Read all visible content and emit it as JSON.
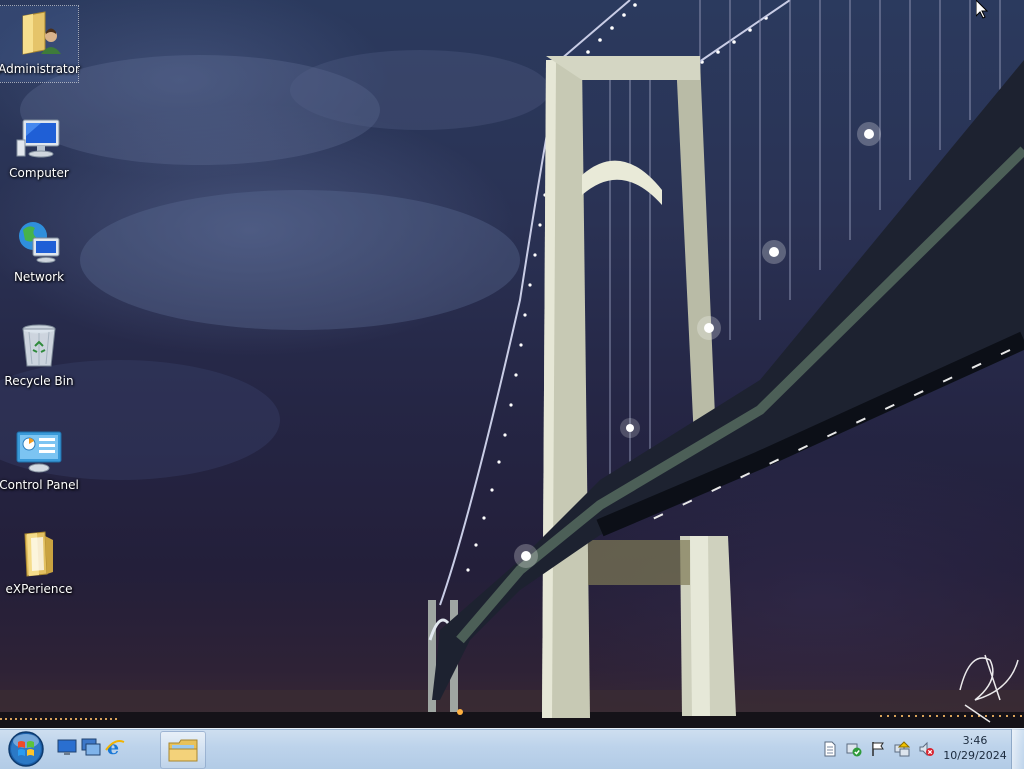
{
  "desktop": {
    "icons": [
      {
        "label": "Administrator",
        "icon": "user-folder-icon",
        "selected": true
      },
      {
        "label": "Computer",
        "icon": "computer-icon",
        "selected": false
      },
      {
        "label": "Network",
        "icon": "network-icon",
        "selected": false
      },
      {
        "label": "Recycle Bin",
        "icon": "recycle-bin-icon",
        "selected": false
      },
      {
        "label": "Control Panel",
        "icon": "control-panel-icon",
        "selected": false
      },
      {
        "label": "eXPerience",
        "icon": "folder-icon",
        "selected": false
      }
    ],
    "wallpaper": "bridge-at-night"
  },
  "taskbar": {
    "start_icon": "windows-orb-icon",
    "quick_launch": [
      "show-desktop-icon",
      "switch-windows-icon",
      "internet-explorer-icon"
    ],
    "tasks": [
      "windows-explorer-icon"
    ],
    "tray_icons": [
      "document-icon",
      "action-center-icon",
      "flag-icon",
      "network-tray-icon",
      "volume-muted-icon"
    ],
    "clock": {
      "time": "3:46",
      "date": "10/29/2024"
    }
  },
  "colors": {
    "taskbar": "#bdd3eb",
    "sky_top": "#2b3a5e",
    "sky_bottom": "#3a2a33",
    "label_text": "#ffffff"
  }
}
